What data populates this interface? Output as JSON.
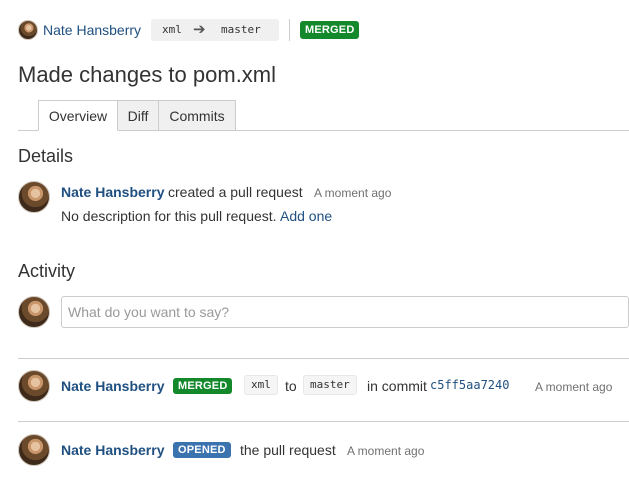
{
  "header": {
    "author": "Nate Hansberry",
    "source_branch": "xml",
    "arrow": "➔",
    "target_branch": "master",
    "state": "MERGED"
  },
  "title": "Made changes to pom.xml",
  "tabs": [
    {
      "label": "Overview",
      "active": true
    },
    {
      "label": "Diff",
      "active": false
    },
    {
      "label": "Commits",
      "active": false
    }
  ],
  "details": {
    "heading": "Details",
    "author": "Nate Hansberry",
    "action": "created a pull request",
    "time": "A moment ago",
    "description": "No description for this pull request.",
    "add_link": "Add one"
  },
  "activity": {
    "heading": "Activity",
    "comment_placeholder": "What do you want to say?",
    "events": [
      {
        "author": "Nate Hansberry",
        "badge": "MERGED",
        "from_branch": "xml",
        "to_word": "to",
        "to_branch": "master",
        "in_commit": "in commit",
        "commit": "c5ff5aa7240",
        "time": "A moment ago"
      },
      {
        "author": "Nate Hansberry",
        "badge": "OPENED",
        "text": "the pull request",
        "time": "A moment ago"
      }
    ]
  },
  "colors": {
    "link": "#205081",
    "merged": "#14892c",
    "opened": "#3b73af"
  }
}
